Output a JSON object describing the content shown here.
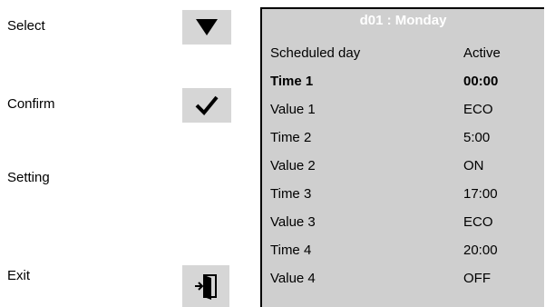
{
  "side_buttons": [
    {
      "label": "Select",
      "icon": "down-triangle-icon"
    },
    {
      "label": "Confirm",
      "icon": "checkmark-icon"
    },
    {
      "label": "Setting"
    },
    {
      "label": "Exit",
      "icon": "exit-door-icon"
    }
  ],
  "screen": {
    "title": "d01 : Monday",
    "header": {
      "name": "Scheduled day",
      "value": "Active"
    },
    "rows": [
      {
        "name": "Time 1",
        "value": "00:00",
        "highlighted": true
      },
      {
        "name": "Value 1",
        "value": "ECO"
      },
      {
        "name": "Time 2",
        "value": "5:00"
      },
      {
        "name": "Value 2",
        "value": "ON"
      },
      {
        "name": "Time 3",
        "value": "17:00"
      },
      {
        "name": "Value 3",
        "value": "ECO"
      },
      {
        "name": "Time 4",
        "value": "20:00"
      },
      {
        "name": "Value 4",
        "value": "OFF"
      }
    ]
  },
  "colors": {
    "key_bg": "#d6d6d6",
    "screen_bg": "#cfcfcf",
    "title_text": "#ffffff"
  }
}
